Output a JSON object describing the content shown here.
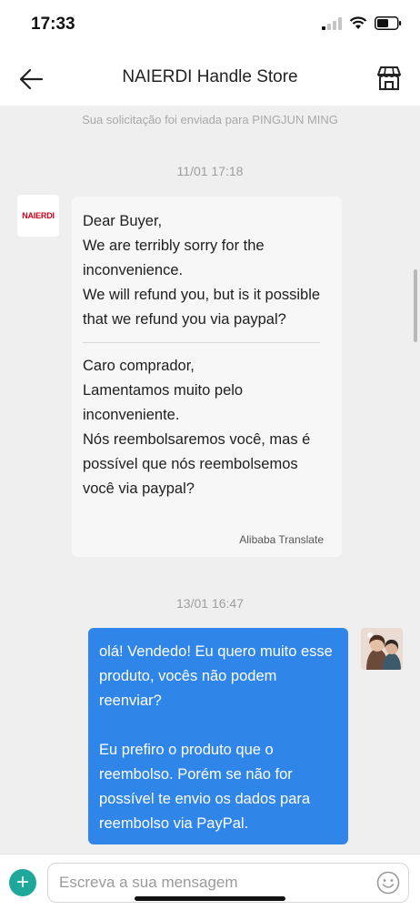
{
  "status_bar": {
    "time": "17:33"
  },
  "header": {
    "title": "NAIERDI Handle Store"
  },
  "chat": {
    "system_notice": "Sua solicitação foi enviada para PINGJUN MING",
    "messages": [
      {
        "timestamp": "11/01 17:18",
        "sender_avatar_text": "NAIERDI",
        "original_text": "Dear Buyer,\nWe are terribly sorry for the inconvenience.\nWe will refund you, but is it possible that we refund you via paypal?",
        "translated_text": "Caro comprador,\nLamentamos muito pelo inconveniente.\nNós reembolsaremos você, mas é possível que nós reembolsemos você via paypal?",
        "translation_label": "Alibaba Translate"
      },
      {
        "timestamp": "13/01 16:47",
        "text": "olá! Vendedo! Eu quero muito esse produto, vocês não podem reenviar?\n\nEu prefiro o produto que o reembolso. Porém se não for possível te envio os dados para reembolso via PayPal."
      }
    ]
  },
  "input_bar": {
    "placeholder": "Escreva a sua mensagem"
  },
  "colors": {
    "accent_blue": "#2f86e8",
    "plus_teal": "#1ea89a",
    "brand_red": "#d0021b"
  }
}
